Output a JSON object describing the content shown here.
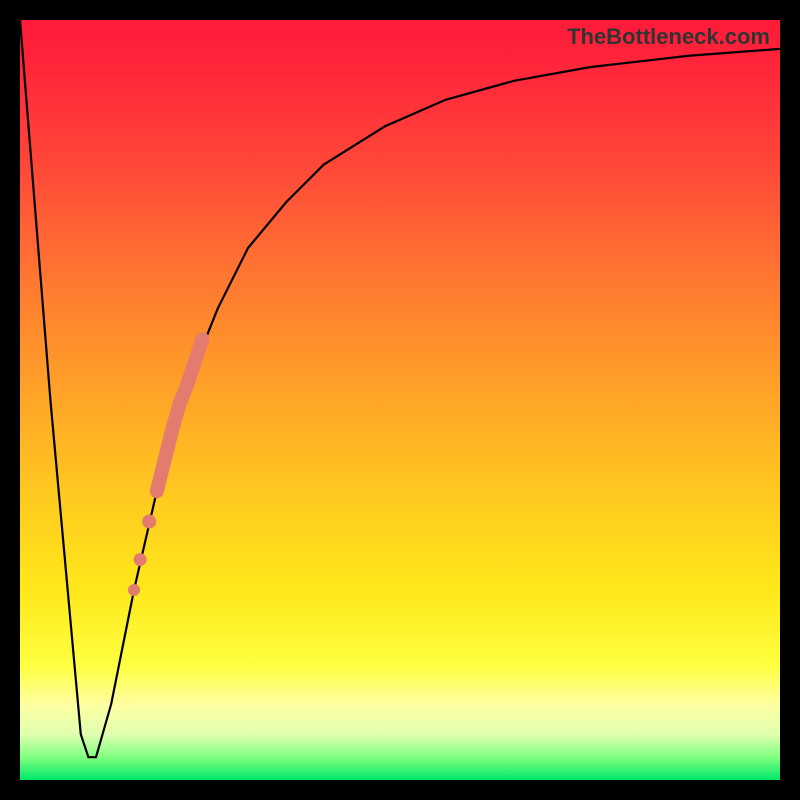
{
  "watermark": "TheBottleneck.com",
  "chart_data": {
    "type": "line",
    "title": "",
    "xlabel": "",
    "ylabel": "",
    "xlim": [
      0,
      100
    ],
    "ylim": [
      0,
      100
    ],
    "background_gradient": {
      "orientation": "vertical",
      "stops": [
        {
          "pos": 0.0,
          "color": "#FF1A3A"
        },
        {
          "pos": 0.5,
          "color": "#FFA028"
        },
        {
          "pos": 0.85,
          "color": "#FDFF40"
        },
        {
          "pos": 1.0,
          "color": "#00E868"
        }
      ]
    },
    "series": [
      {
        "name": "bottleneck-curve",
        "type": "line",
        "color": "#000000",
        "x": [
          0,
          4,
          8,
          9,
          10,
          12,
          15,
          18,
          22,
          26,
          30,
          35,
          40,
          48,
          56,
          65,
          75,
          88,
          100
        ],
        "y": [
          100,
          50,
          6,
          3,
          3,
          10,
          25,
          38,
          52,
          62,
          70,
          76,
          81,
          86,
          89.5,
          92,
          93.8,
          95.3,
          96.2
        ]
      },
      {
        "name": "highlight-markers",
        "type": "scatter",
        "color": "#E37B6F",
        "x": [
          15.0,
          15.8,
          17.0,
          18.0,
          19.0,
          20.0,
          21.0,
          22.0,
          23.0,
          24.0
        ],
        "y": [
          25.0,
          29.0,
          34.0,
          38.0,
          42.0,
          46.0,
          49.5,
          52.0,
          55.0,
          58.0
        ]
      }
    ]
  }
}
